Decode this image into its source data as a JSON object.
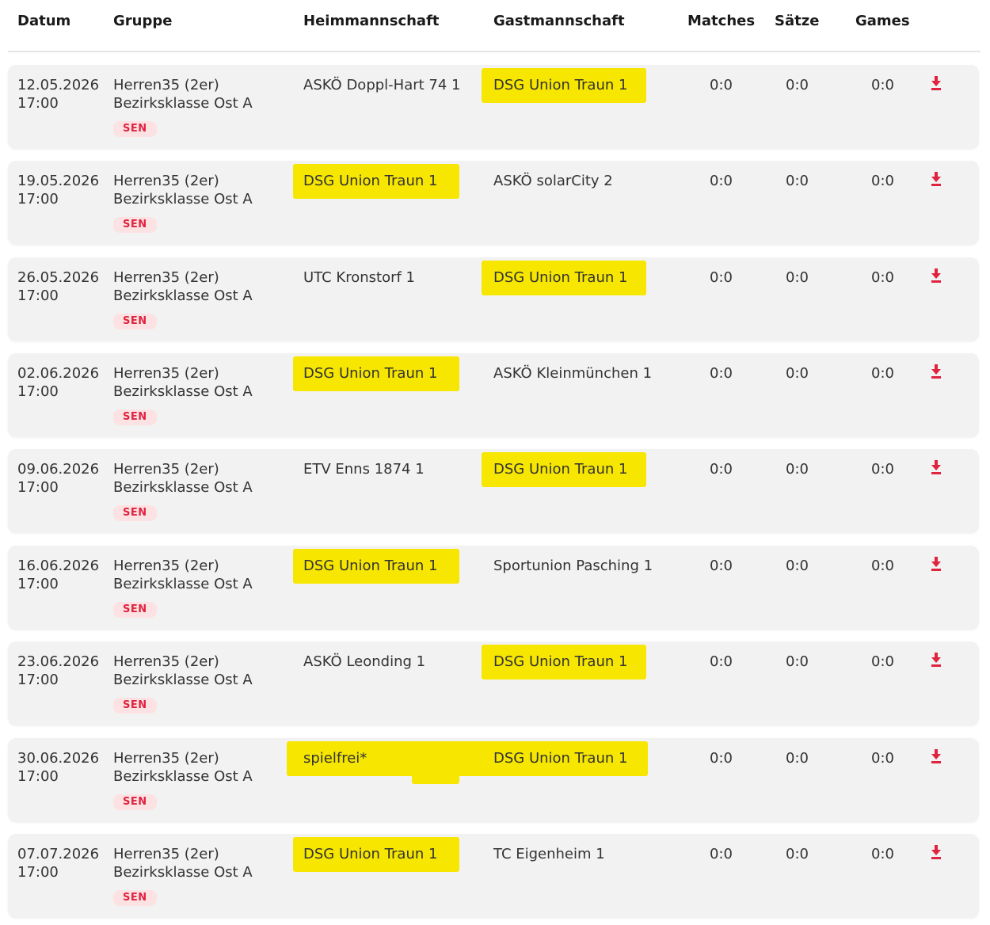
{
  "columns": {
    "datum": "Datum",
    "gruppe": "Gruppe",
    "heim": "Heimmannschaft",
    "gast": "Gastmannschaft",
    "matches": "Matches",
    "saetze": "Sätze",
    "games": "Games"
  },
  "highlight_color": "#f6e600",
  "accent_color": "#e0233f",
  "matches": [
    {
      "date": "12.05.2026",
      "time": "17:00",
      "group_1": "Herren35 (2er)",
      "group_2": "Bezirksklasse Ost A",
      "badge": "SEN",
      "home": "ASKÖ Doppl-Hart 74 1",
      "away": "DSG Union Traun 1",
      "matches": "0:0",
      "saetze": "0:0",
      "games": "0:0",
      "highlight": "away",
      "download_icon": "download-icon"
    },
    {
      "date": "19.05.2026",
      "time": "17:00",
      "group_1": "Herren35 (2er)",
      "group_2": "Bezirksklasse Ost A",
      "badge": "SEN",
      "home": "DSG Union Traun 1",
      "away": "ASKÖ solarCity 2",
      "matches": "0:0",
      "saetze": "0:0",
      "games": "0:0",
      "highlight": "home",
      "download_icon": "download-icon"
    },
    {
      "date": "26.05.2026",
      "time": "17:00",
      "group_1": "Herren35 (2er)",
      "group_2": "Bezirksklasse Ost A",
      "badge": "SEN",
      "home": "UTC Kronstorf 1",
      "away": "DSG Union Traun 1",
      "matches": "0:0",
      "saetze": "0:0",
      "games": "0:0",
      "highlight": "away",
      "download_icon": "download-icon"
    },
    {
      "date": "02.06.2026",
      "time": "17:00",
      "group_1": "Herren35 (2er)",
      "group_2": "Bezirksklasse Ost A",
      "badge": "SEN",
      "home": "DSG Union Traun 1",
      "away": "ASKÖ Kleinmünchen 1",
      "matches": "0:0",
      "saetze": "0:0",
      "games": "0:0",
      "highlight": "home",
      "download_icon": "download-icon"
    },
    {
      "date": "09.06.2026",
      "time": "17:00",
      "group_1": "Herren35 (2er)",
      "group_2": "Bezirksklasse Ost A",
      "badge": "SEN",
      "home": "ETV Enns 1874 1",
      "away": "DSG Union Traun 1",
      "matches": "0:0",
      "saetze": "0:0",
      "games": "0:0",
      "highlight": "away",
      "download_icon": "download-icon"
    },
    {
      "date": "16.06.2026",
      "time": "17:00",
      "group_1": "Herren35 (2er)",
      "group_2": "Bezirksklasse Ost A",
      "badge": "SEN",
      "home": "DSG Union Traun 1",
      "away": "Sportunion Pasching 1",
      "matches": "0:0",
      "saetze": "0:0",
      "games": "0:0",
      "highlight": "home",
      "download_icon": "download-icon"
    },
    {
      "date": "23.06.2026",
      "time": "17:00",
      "group_1": "Herren35 (2er)",
      "group_2": "Bezirksklasse Ost A",
      "badge": "SEN",
      "home": "ASKÖ Leonding 1",
      "away": "DSG Union Traun 1",
      "matches": "0:0",
      "saetze": "0:0",
      "games": "0:0",
      "highlight": "away",
      "download_icon": "download-icon"
    },
    {
      "date": "30.06.2026",
      "time": "17:00",
      "group_1": "Herren35 (2er)",
      "group_2": "Bezirksklasse Ost A",
      "badge": "SEN",
      "home": "spielfrei*",
      "away": "DSG Union Traun 1",
      "matches": "0:0",
      "saetze": "0:0",
      "games": "0:0",
      "highlight": "both",
      "download_icon": "download-icon"
    },
    {
      "date": "07.07.2026",
      "time": "17:00",
      "group_1": "Herren35 (2er)",
      "group_2": "Bezirksklasse Ost A",
      "badge": "SEN",
      "home": "DSG Union Traun 1",
      "away": "TC Eigenheim 1",
      "matches": "0:0",
      "saetze": "0:0",
      "games": "0:0",
      "highlight": "home",
      "download_icon": "download-icon"
    }
  ]
}
